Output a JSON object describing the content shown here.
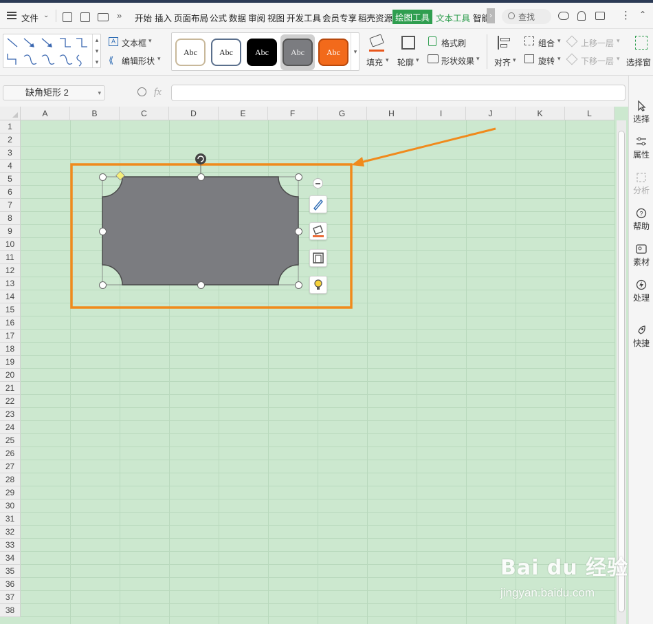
{
  "menubar": {
    "file_label": "文件",
    "tabs": [
      "开始",
      "插入",
      "页面布局",
      "公式",
      "数据",
      "审阅",
      "视图",
      "开发工具",
      "会员专享",
      "稻壳资源",
      "绘图工具",
      "文本工具",
      "智能"
    ],
    "active_tab": "绘图工具",
    "search_label": "查找"
  },
  "ribbon": {
    "textbox_label": "文本框",
    "edit_shape_label": "编辑形状",
    "style_sample": "Abc",
    "fill_label": "填充",
    "outline_label": "轮廓",
    "format_brush_label": "格式刷",
    "shape_effect_label": "形状效果",
    "align_label": "对齐",
    "group_label": "组合",
    "rotate_label": "旋转",
    "bring_forward_label": "上移一层",
    "send_backward_label": "下移一层",
    "select_pane_label": "选择窗"
  },
  "formula_bar": {
    "name_box_value": "缺角矩形 2",
    "fx_label": "fx",
    "formula_value": ""
  },
  "sheet": {
    "columns": [
      "A",
      "B",
      "C",
      "D",
      "E",
      "F",
      "G",
      "H",
      "I",
      "J",
      "K",
      "L"
    ],
    "rows": [
      "1",
      "2",
      "3",
      "4",
      "5",
      "6",
      "7",
      "8",
      "9",
      "10",
      "11",
      "12",
      "13",
      "14",
      "15",
      "16",
      "17",
      "18",
      "19",
      "20",
      "21",
      "22",
      "23",
      "24",
      "25",
      "26",
      "27",
      "28",
      "29",
      "30",
      "31",
      "32",
      "33",
      "34",
      "35",
      "36",
      "37",
      "38"
    ]
  },
  "right_panel": {
    "items": [
      {
        "label": "选择",
        "icon": "cursor-icon"
      },
      {
        "label": "属性",
        "icon": "sliders-icon"
      },
      {
        "label": "分析",
        "icon": "analysis-icon"
      },
      {
        "label": "帮助",
        "icon": "help-icon"
      },
      {
        "label": "素材",
        "icon": "material-icon"
      },
      {
        "label": "处理",
        "icon": "process-icon"
      },
      {
        "label": "快捷",
        "icon": "rocket-icon"
      }
    ]
  },
  "colors": {
    "sheet_bg": "#cce8cf",
    "shape_fill": "#7b7c80",
    "highlight_orange": "#f08a1c",
    "active_tab_bg": "#2f9e4f"
  },
  "watermark": {
    "brand": "Bai du 经验",
    "url": "jingyan.baidu.com"
  }
}
